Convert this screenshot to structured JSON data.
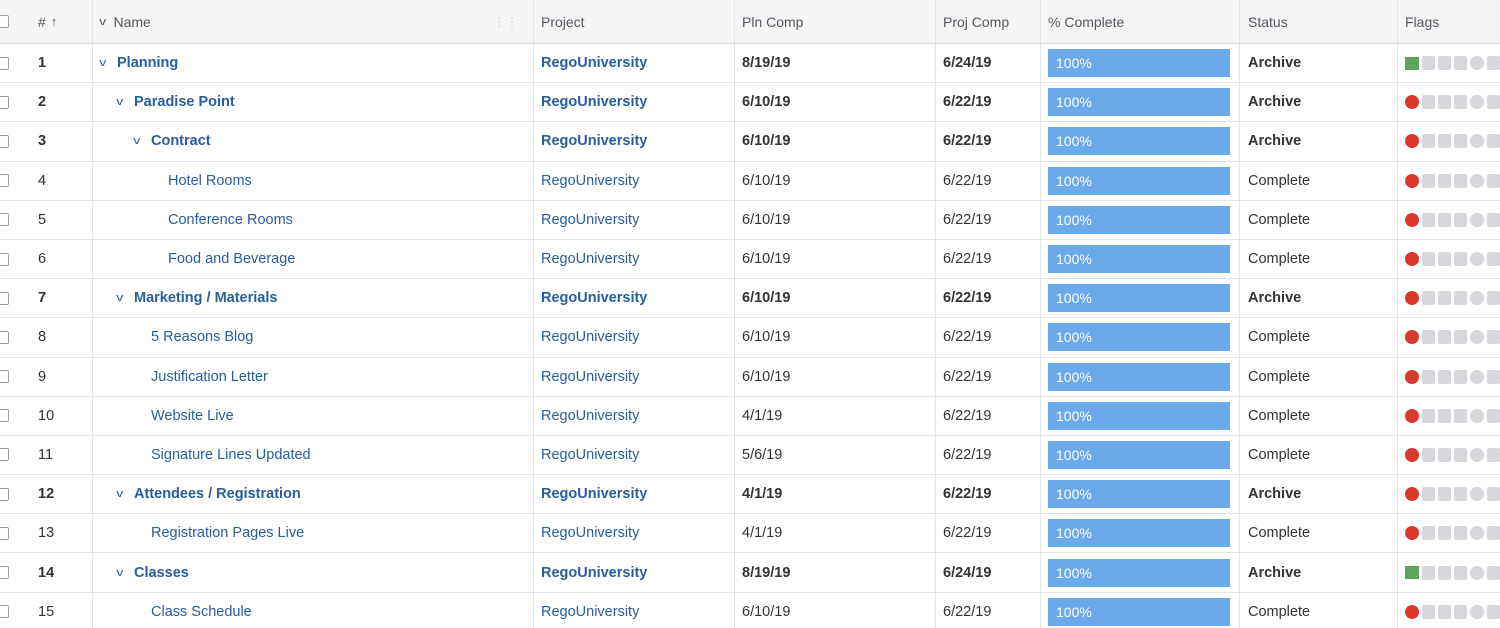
{
  "header": {
    "num": "#",
    "sort_arrow": "↑",
    "name": "Name",
    "project": "Project",
    "pln_comp": "Pln Comp",
    "proj_comp": "Proj Comp",
    "pct_complete": "% Complete",
    "status": "Status",
    "flags": "Flags"
  },
  "colors": {
    "progress": "#6aa9ea",
    "link": "#2a5d9c",
    "flag_red": "#d9392b",
    "flag_green": "#5ba65a"
  },
  "rows": [
    {
      "num": "1",
      "name": "Planning",
      "project": "RegoUniversity",
      "pln": "8/19/19",
      "proj": "6/24/19",
      "pct": "100%",
      "status": "Archive",
      "bold": true,
      "expand": true,
      "indent": 0,
      "flag": "green"
    },
    {
      "num": "2",
      "name": "Paradise Point",
      "project": "RegoUniversity",
      "pln": "6/10/19",
      "proj": "6/22/19",
      "pct": "100%",
      "status": "Archive",
      "bold": true,
      "expand": true,
      "indent": 1,
      "flag": "red"
    },
    {
      "num": "3",
      "name": "Contract",
      "project": "RegoUniversity",
      "pln": "6/10/19",
      "proj": "6/22/19",
      "pct": "100%",
      "status": "Archive",
      "bold": true,
      "expand": true,
      "indent": 2,
      "flag": "red"
    },
    {
      "num": "4",
      "name": "Hotel Rooms",
      "project": "RegoUniversity",
      "pln": "6/10/19",
      "proj": "6/22/19",
      "pct": "100%",
      "status": "Complete",
      "bold": false,
      "expand": false,
      "indent": 3,
      "flag": "red"
    },
    {
      "num": "5",
      "name": "Conference Rooms",
      "project": "RegoUniversity",
      "pln": "6/10/19",
      "proj": "6/22/19",
      "pct": "100%",
      "status": "Complete",
      "bold": false,
      "expand": false,
      "indent": 3,
      "flag": "red"
    },
    {
      "num": "6",
      "name": "Food and Beverage",
      "project": "RegoUniversity",
      "pln": "6/10/19",
      "proj": "6/22/19",
      "pct": "100%",
      "status": "Complete",
      "bold": false,
      "expand": false,
      "indent": 3,
      "flag": "red"
    },
    {
      "num": "7",
      "name": "Marketing / Materials",
      "project": "RegoUniversity",
      "pln": "6/10/19",
      "proj": "6/22/19",
      "pct": "100%",
      "status": "Archive",
      "bold": true,
      "expand": true,
      "indent": 1,
      "flag": "red"
    },
    {
      "num": "8",
      "name": "5 Reasons Blog",
      "project": "RegoUniversity",
      "pln": "6/10/19",
      "proj": "6/22/19",
      "pct": "100%",
      "status": "Complete",
      "bold": false,
      "expand": false,
      "indent": 2,
      "flag": "red"
    },
    {
      "num": "9",
      "name": "Justification Letter",
      "project": "RegoUniversity",
      "pln": "6/10/19",
      "proj": "6/22/19",
      "pct": "100%",
      "status": "Complete",
      "bold": false,
      "expand": false,
      "indent": 2,
      "flag": "red"
    },
    {
      "num": "10",
      "name": "Website Live",
      "project": "RegoUniversity",
      "pln": "4/1/19",
      "proj": "6/22/19",
      "pct": "100%",
      "status": "Complete",
      "bold": false,
      "expand": false,
      "indent": 2,
      "flag": "red"
    },
    {
      "num": "11",
      "name": "Signature Lines Updated",
      "project": "RegoUniversity",
      "pln": "5/6/19",
      "proj": "6/22/19",
      "pct": "100%",
      "status": "Complete",
      "bold": false,
      "expand": false,
      "indent": 2,
      "flag": "red"
    },
    {
      "num": "12",
      "name": "Attendees / Registration",
      "project": "RegoUniversity",
      "pln": "4/1/19",
      "proj": "6/22/19",
      "pct": "100%",
      "status": "Archive",
      "bold": true,
      "expand": true,
      "indent": 1,
      "flag": "red"
    },
    {
      "num": "13",
      "name": "Registration Pages Live",
      "project": "RegoUniversity",
      "pln": "4/1/19",
      "proj": "6/22/19",
      "pct": "100%",
      "status": "Complete",
      "bold": false,
      "expand": false,
      "indent": 2,
      "flag": "red"
    },
    {
      "num": "14",
      "name": "Classes",
      "project": "RegoUniversity",
      "pln": "8/19/19",
      "proj": "6/24/19",
      "pct": "100%",
      "status": "Archive",
      "bold": true,
      "expand": true,
      "indent": 1,
      "flag": "green"
    },
    {
      "num": "15",
      "name": "Class Schedule",
      "project": "RegoUniversity",
      "pln": "6/10/19",
      "proj": "6/22/19",
      "pct": "100%",
      "status": "Complete",
      "bold": false,
      "expand": false,
      "indent": 2,
      "flag": "red"
    }
  ]
}
